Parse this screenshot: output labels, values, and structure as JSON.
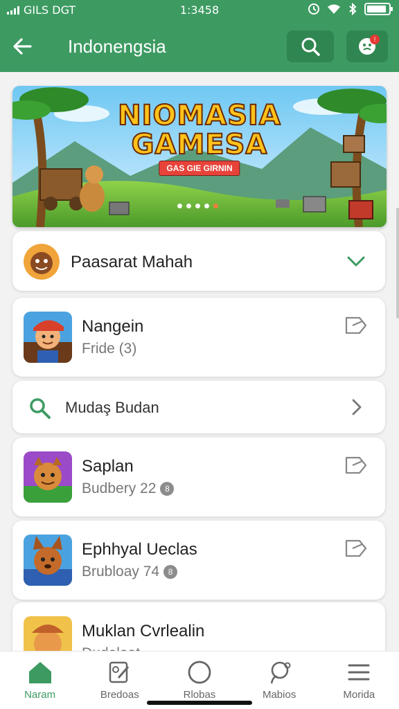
{
  "status_bar": {
    "carrier": "GILS DGT",
    "time": "1:3458",
    "battery_level": 0.9
  },
  "header": {
    "title": "Indonengsia",
    "back_icon": "arrow-left-icon",
    "search_icon": "search-icon",
    "notification_icon": "face-icon",
    "notification_badge": "!"
  },
  "banner": {
    "title_line1": "NIOMASIA",
    "title_line2": "GAMESA",
    "subtitle": "GAS GIE GIRNIN",
    "slide_count": 5,
    "active_slide": 4
  },
  "cards": [
    {
      "title": "Paasarat Mahah",
      "action_icon": "check-icon"
    },
    {
      "title": "Nangein",
      "subtitle": "Fride (3)",
      "action_icon": "share-icon"
    },
    {
      "title": "Mudaş Budan",
      "leading_icon": "search-icon",
      "action_icon": "chevron-right-icon"
    },
    {
      "title": "Saplan",
      "subtitle": "Budbery 22",
      "badge": "8",
      "action_icon": "share-icon"
    },
    {
      "title": "Ephhyal Ueclas",
      "subtitle": "Brubloay 74",
      "badge": "8",
      "action_icon": "share-icon"
    },
    {
      "title": "Muklan Cvrlealin",
      "subtitle": "Dudeloat"
    }
  ],
  "bottom_nav": [
    {
      "label": "Naram",
      "icon": "home-icon",
      "active": true
    },
    {
      "label": "Bredoas",
      "icon": "edit-icon",
      "active": false
    },
    {
      "label": "Rlobas",
      "icon": "circle-icon",
      "active": false
    },
    {
      "label": "Mabios",
      "icon": "chat-icon",
      "active": false
    },
    {
      "label": "Morida",
      "icon": "menu-icon",
      "active": false
    }
  ],
  "colors": {
    "primary": "#3d9b62",
    "primary_dark": "#2f8650",
    "badge_red": "#e53935"
  }
}
